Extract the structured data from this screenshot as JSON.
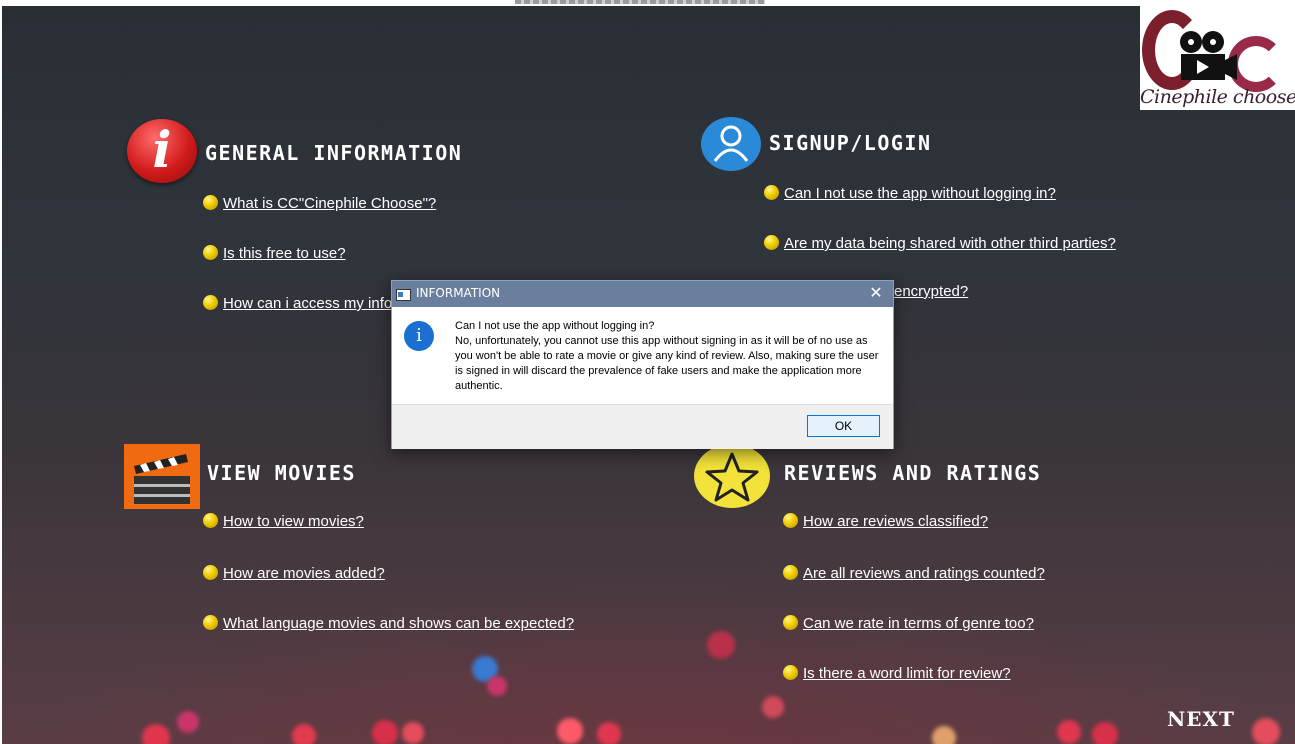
{
  "logo": {
    "text": "Cinephile choose"
  },
  "sections": {
    "general": {
      "title": "GENERAL INFORMATION",
      "links": [
        "What is CC\"Cinephile Choose\"?",
        "Is this free to use?",
        "How can i access my info"
      ]
    },
    "signup": {
      "title": "SIGNUP/LOGIN",
      "links": [
        "Can I not use the app without logging in?",
        "Are my data being shared with other third parties?",
        "encrypted?"
      ]
    },
    "movies": {
      "title": "VIEW MOVIES",
      "links": [
        "How to view movies?",
        "How are movies added?",
        "What language movies and shows can be expected?"
      ]
    },
    "reviews": {
      "title": "REVIEWS AND RATINGS",
      "links": [
        "How are reviews classified?",
        "Are all reviews and ratings counted?",
        "Can we rate in terms of genre too?",
        "Is there a word limit for review?"
      ]
    }
  },
  "next_label": "NEXT",
  "dialog": {
    "title": "INFORMATION",
    "close_glyph": "✕",
    "info_glyph": "i",
    "question": "Can I not use the app without logging in?",
    "answer": "No, unfortunately, you cannot use this app without signing in as it will be of no use as you won't be able to rate a movie or give any kind of review. Also, making sure the user is signed in will discard the prevalence of fake users and make the application more authentic.",
    "ok_label": "OK"
  },
  "colors": {
    "info_red": "#d21b1b",
    "user_blue": "#2b8ad8",
    "clap_orange": "#f06a12",
    "star_yellow": "#f3e23a",
    "bullet_yellow": "#f3d000",
    "dialog_title_bar": "#6a7f9e"
  }
}
